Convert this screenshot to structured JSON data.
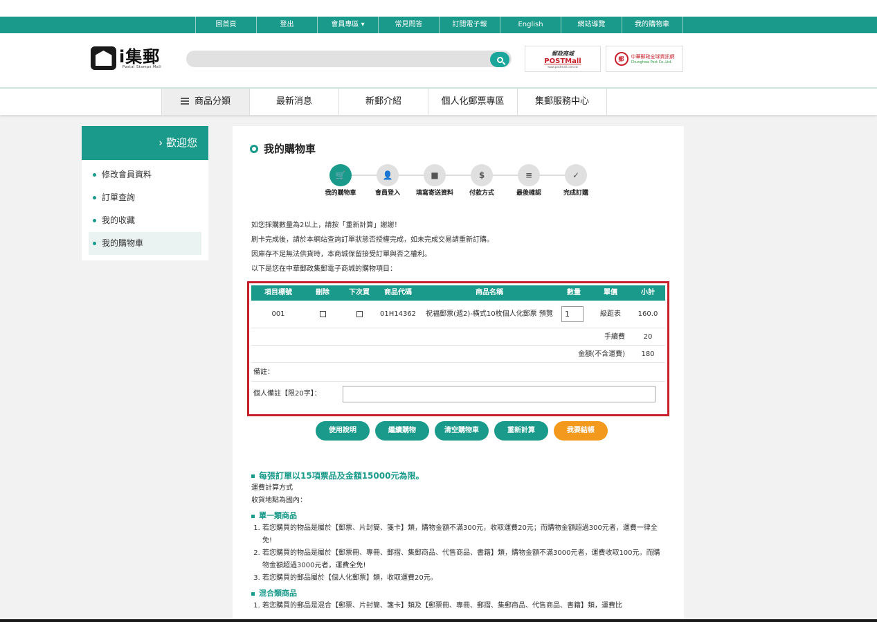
{
  "topbar": {
    "links": [
      "回首頁",
      "登出",
      "會員專區 ▾",
      "常見問答",
      "訂閱電子報",
      "English",
      "網站導覽",
      "我的購物車"
    ]
  },
  "header": {
    "logo_text": "i集郵",
    "logo_sub": "Postal Stamps Mall",
    "partner1": {
      "a": "郵政商城",
      "b": "POSTMall",
      "c": "www.postmall.com.tw"
    },
    "partner2": {
      "seal": "郵",
      "t1": "中華郵政全球資訊網",
      "t2": "Chunghwa Post Co.,Ltd."
    }
  },
  "mainnav": {
    "items": [
      "商品分類",
      "最新消息",
      "新郵介紹",
      "個人化郵票專區",
      "集郵服務中心"
    ]
  },
  "sidebar": {
    "title": "› 歡迎您",
    "items": [
      "修改會員資料",
      "訂單查詢",
      "我的收藏",
      "我的購物車"
    ]
  },
  "content": {
    "title": "我的購物車",
    "steps": [
      {
        "label": "我的購物車",
        "icon": "cart-icon"
      },
      {
        "label": "會員登入",
        "icon": "user-icon"
      },
      {
        "label": "填寫寄送資料",
        "icon": "box-icon"
      },
      {
        "label": "付款方式",
        "icon": "dollar-icon"
      },
      {
        "label": "最後確認",
        "icon": "document-icon"
      },
      {
        "label": "完成訂購",
        "icon": "check-icon"
      }
    ],
    "notes": [
      "如您採購數量為2以上，請按「重新計算」謝謝！",
      "刷卡完成後，請於本網站查詢訂單狀態否授權完成，如未完成交易請重新訂購。",
      "因庫存不足無法供貨時，本商城保留接受訂單與否之權利。",
      "以下是您在中華郵政集郵電子商城的購物項目："
    ]
  },
  "cart": {
    "headers": [
      "項目標號",
      "刪除",
      "下次買",
      "商品代碼",
      "商品名稱",
      "數量",
      "單價",
      "小計"
    ],
    "item": {
      "no": "001",
      "code": "01H14362",
      "name": "祝福郵票(遞2)-橫式10枚個人化郵票 預覽",
      "qty": "1",
      "price": "級距表",
      "subtotal": "160.0"
    },
    "fee_label": "手續費",
    "fee_value": "20",
    "total_label": "金額(不含運費)",
    "total_value": "180",
    "remark_label": "備註：",
    "memo_label": "個人備註【限20字】："
  },
  "actions": [
    "使用說明",
    "繼續購物",
    "清空購物車",
    "重新計算",
    "我要結帳"
  ],
  "shipping": {
    "heading": "每張訂單以15項票品及金額15000元為限。",
    "method": "運費計算方式",
    "place": "收貨地點為國內：",
    "single_title": "單一類商品",
    "single_items": [
      "若您購買的物品是屬於【郵票、片封簡、箋卡】類，購物金額不滿300元，收取運費20元；而購物金額超過300元者，運費一律全免!",
      "若您購買的物品是屬於【郵票冊、專冊、郵摺、集郵商品、代售商品、書籍】類，購物金額不滿3000元者，運費收取100元。而購物金額超過3000元者，運費全免!",
      "若您購買的郵品屬於【個人化郵票】類，收取運費20元。"
    ],
    "mixed_title": "混合類商品",
    "mixed_items": [
      "若您購買的郵品是混合【郵票、片封簡、箋卡】類及【郵票冊、專冊、郵摺、集郵商品、代售商品、書籍】類，運費比"
    ]
  },
  "colors": {
    "brand": "#1a9a8a",
    "highlight": "#c8202a",
    "checkout": "#f39a1e"
  }
}
